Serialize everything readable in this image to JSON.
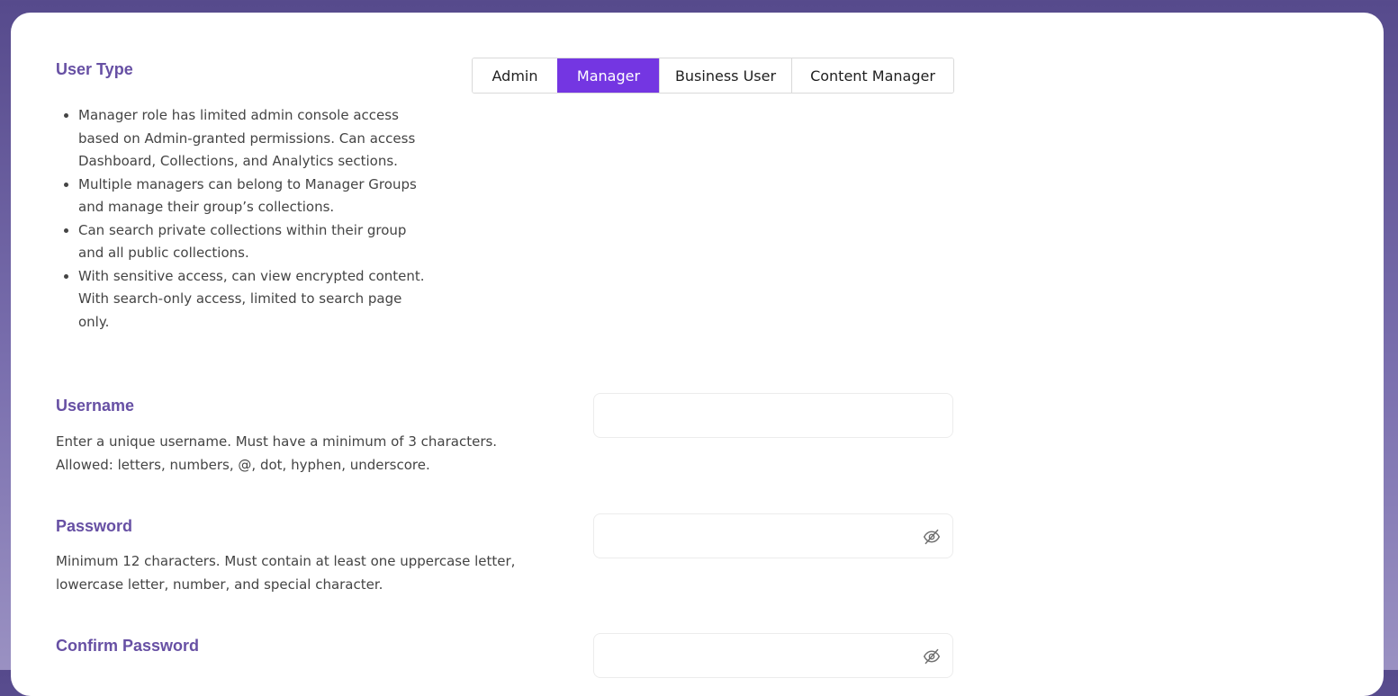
{
  "user_type": {
    "title": "User Type",
    "bullets": [
      "Manager role has limited admin console access based on Admin-granted permissions. Can access Dashboard, Collections, and Analytics sections.",
      "Multiple managers can belong to Manager Groups and manage their group’s collections.",
      "Can search private collections within their group and all public collections.",
      "With sensitive access, can view encrypted content. With search-only access, limited to search page only."
    ],
    "options": [
      "Admin",
      "Manager",
      "Business User",
      "Content Manager"
    ],
    "selected": "Manager",
    "accent_color": "#7436e2"
  },
  "username": {
    "title": "Username",
    "description_lines": [
      "Enter a unique username. Must have a minimum of 3 characters.",
      "Allowed: letters, numbers, @, dot, hyphen, underscore."
    ],
    "value": ""
  },
  "password": {
    "title": "Password",
    "description_lines": [
      "Minimum 12 characters. Must contain at least one uppercase letter,",
      "lowercase letter, number, and special character."
    ],
    "value": "",
    "icon": "eye-off-icon"
  },
  "confirm_password": {
    "title": "Confirm Password",
    "value": "",
    "icon": "eye-off-icon"
  },
  "colors": {
    "section_title": "#6750a4",
    "background_top": "#564a8c",
    "background_bottom": "#9a91c2"
  }
}
